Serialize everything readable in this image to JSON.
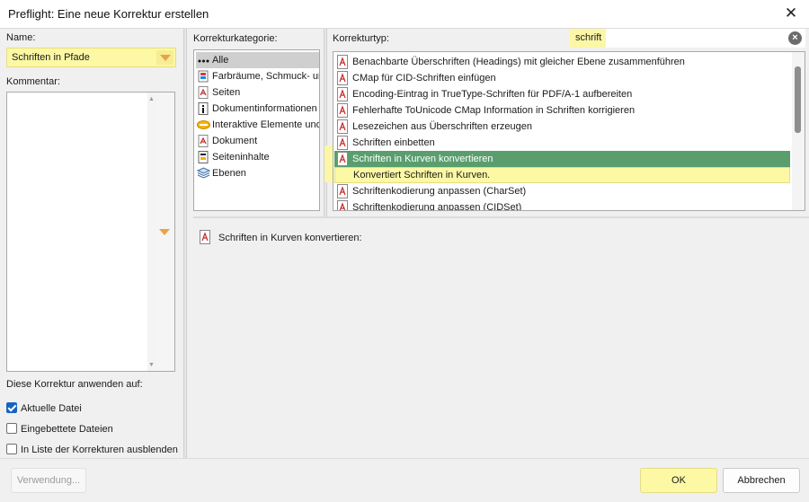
{
  "window": {
    "title": "Preflight: Eine neue Korrektur erstellen"
  },
  "left": {
    "name_label": "Name:",
    "name_value": "Schriften in Pfade",
    "comment_label": "Kommentar:",
    "comment_value": "",
    "apply_label": "Diese Korrektur anwenden auf:",
    "checks": [
      {
        "label": "Aktuelle Datei",
        "checked": true
      },
      {
        "label": "Eingebettete Dateien",
        "checked": false
      },
      {
        "label": "In Liste der Korrekturen ausblenden",
        "checked": false
      }
    ]
  },
  "category": {
    "label": "Korrekturkategorie:",
    "items": [
      {
        "label": "Alle",
        "icon": "dots-icon",
        "selected": true
      },
      {
        "label": "Farbräume, Schmuck- und",
        "icon": "color-icon"
      },
      {
        "label": "Seiten",
        "icon": "pdf-icon"
      },
      {
        "label": "Dokumentinformationen",
        "icon": "info-icon"
      },
      {
        "label": "Interaktive Elemente und",
        "icon": "interactive-icon"
      },
      {
        "label": "Dokument",
        "icon": "pdf-icon"
      },
      {
        "label": "Seiteninhalte",
        "icon": "content-icon"
      },
      {
        "label": "Ebenen",
        "icon": "layers-icon"
      }
    ]
  },
  "type": {
    "label": "Korrekturtyp:",
    "search_value": "schrift",
    "items": [
      {
        "label": "Benachbarte Überschriften (Headings) mit gleicher Ebene zusammenführen"
      },
      {
        "label": "CMap für CID-Schriften einfügen"
      },
      {
        "label": "Encoding-Eintrag in TrueType-Schriften für PDF/A-1 aufbereiten"
      },
      {
        "label": "Fehlerhafte ToUnicode CMap Information in Schriften korrigieren"
      },
      {
        "label": "Lesezeichen aus Überschriften erzeugen"
      },
      {
        "label": "Schriften einbetten"
      },
      {
        "label": "Schriften in Kurven konvertieren",
        "selected": true
      },
      {
        "label": "Konvertiert Schriften in Kurven.",
        "description": true
      },
      {
        "label": "Schriftenkodierung anpassen (CharSet)"
      },
      {
        "label": "Schriftenkodierung anpassen (CIDSet)"
      }
    ]
  },
  "detail": {
    "label": "Schriften in Kurven konvertieren:"
  },
  "buttons": {
    "usage": "Verwendung...",
    "ok": "OK",
    "cancel": "Abbrechen"
  },
  "colors": {
    "selection": "#5a9e6e",
    "highlight": "#fbf7a6",
    "accent": "#e8a34a",
    "check": "#1565c0"
  }
}
